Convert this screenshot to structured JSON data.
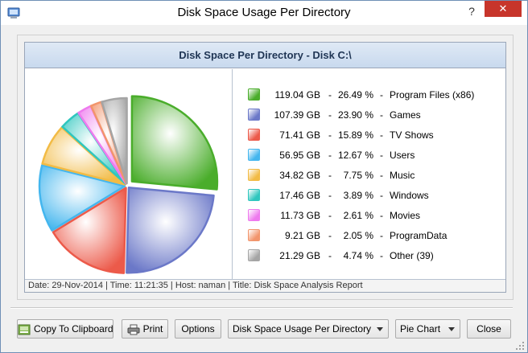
{
  "window": {
    "title": "Disk Space Usage Per Directory",
    "help_label": "?",
    "close_label": "✕"
  },
  "chart_header": "Disk Space Per Directory - Disk C:\\",
  "chart_data": {
    "type": "pie",
    "title": "Disk Space Per Directory - Disk C:\\",
    "slices": [
      {
        "name": "Program Files (x86)",
        "size": "119.04 GB",
        "percent": 26.49,
        "percent_label": "26.49 %",
        "color": "#4aad2b"
      },
      {
        "name": "Games",
        "size": "107.39 GB",
        "percent": 23.9,
        "percent_label": "23.90 %",
        "color": "#6b78c8"
      },
      {
        "name": "TV Shows",
        "size": "71.41 GB",
        "percent": 15.89,
        "percent_label": "15.89 %",
        "color": "#ec5a4a"
      },
      {
        "name": "Users",
        "size": "56.95 GB",
        "percent": 12.67,
        "percent_label": "12.67 %",
        "color": "#44b6ee"
      },
      {
        "name": "Music",
        "size": "34.82 GB",
        "percent": 7.75,
        "percent_label": "7.75 %",
        "color": "#f2bb45"
      },
      {
        "name": "Windows",
        "size": "17.46 GB",
        "percent": 3.89,
        "percent_label": "3.89 %",
        "color": "#2fc6be"
      },
      {
        "name": "Movies",
        "size": "11.73 GB",
        "percent": 2.61,
        "percent_label": "2.61 %",
        "color": "#ee7aee"
      },
      {
        "name": "ProgramData",
        "size": "9.21 GB",
        "percent": 2.05,
        "percent_label": "2.05 %",
        "color": "#f2956c"
      },
      {
        "name": "Other (39)",
        "size": "21.29 GB",
        "percent": 4.74,
        "percent_label": "4.74 %",
        "color": "#a5a5a5"
      }
    ],
    "separator": "-"
  },
  "status_text": "Date: 29-Nov-2014 | Time: 11:21:35 | Host: naman | Title: Disk Space Analysis Report",
  "buttons": {
    "copy": "Copy To Clipboard",
    "print": "Print",
    "options": "Options",
    "close": "Close"
  },
  "combos": {
    "report": "Disk Space Usage Per Directory",
    "chart_type": "Pie Chart"
  }
}
